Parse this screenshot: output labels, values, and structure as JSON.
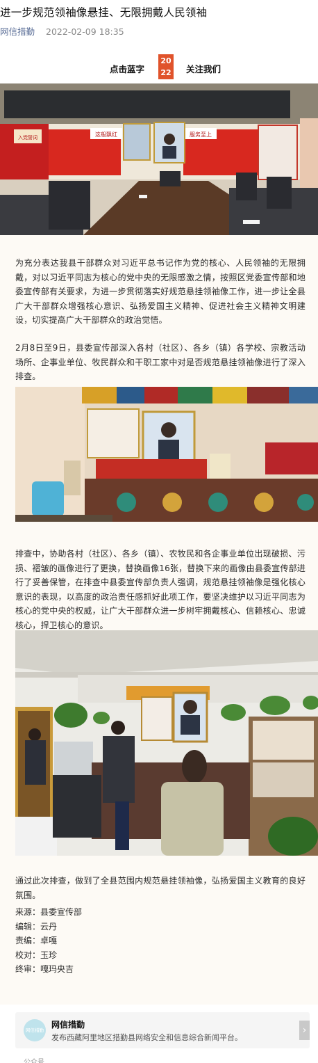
{
  "article": {
    "title": "进一步规范领袖像悬挂、无限拥戴人民领袖",
    "account": "网信措勤",
    "datetime": "2022-02-09 18:35"
  },
  "follow_bar": {
    "left_text": "点击蓝字",
    "badge_line1": "20",
    "badge_line2": "22",
    "right_text": "关注我们"
  },
  "paragraphs": [
    "为充分表达我县干部群众对习近平总书记作为党的核心、人民领袖的无限拥戴，对以习近平同志为核心的党中央的无限感激之情，按照区党委宣传部和地委宣传部有关要求，为进一步贯彻落实好规范悬挂领袖像工作，进一步让全县广大干部群众增强核心意识、弘扬爱国主义精神、促进社会主义精神文明建设，切实提高广大干部群众的政治觉悟。",
    "2月8日至9日，县委宣传部深入各村（社区）、各乡（镇）各学校、宗教活动场所、企事业单位、牧民群众和干职工家中对是否规范悬挂领袖像进行了深入排查。",
    "排查中，协助各村（社区）、各乡（镇）、农牧民和各企事业单位出现破损、污损、褶皱的画像进行了更换，替换画像16张，替换下来的画像由县委宣传部进行了妥善保管，在排查中县委宣传部负责人强调，规范悬挂领袖像是强化核心意识的表现，以高度的政治责任感抓好此项工作，要坚决维护以习近平同志为核心的党中央的权威，让广大干部群众进一步树牢拥戴核心、信赖核心、忠诚核心，捍卫核心的意识。",
    "通过此次排查，做到了全县范围内规范悬挂领袖像，弘扬爱国主义教育的良好氛围。"
  ],
  "credits": [
    {
      "label": "来源：",
      "value": "县委宣传部"
    },
    {
      "label": "编辑：",
      "value": "云丹"
    },
    {
      "label": "责编：",
      "value": "卓嘎"
    },
    {
      "label": "校对：",
      "value": "玉珍"
    },
    {
      "label": "终审：",
      "value": "嘎玛央吉"
    }
  ],
  "photo1_signs": {
    "left": "这般飘红",
    "right": "服务至上",
    "board": "入党誓词"
  },
  "account_card": {
    "logo_text": "网信措勤",
    "name": "网信措勤",
    "description": "发布西藏阿里地区措勤县网络安全和信息综合新闻平台。",
    "arrow": "›"
  },
  "footer_label": "公众号",
  "colors": {
    "link": "#576b95",
    "badge": "#e0532b",
    "body_bg": "#fdfaf5"
  }
}
